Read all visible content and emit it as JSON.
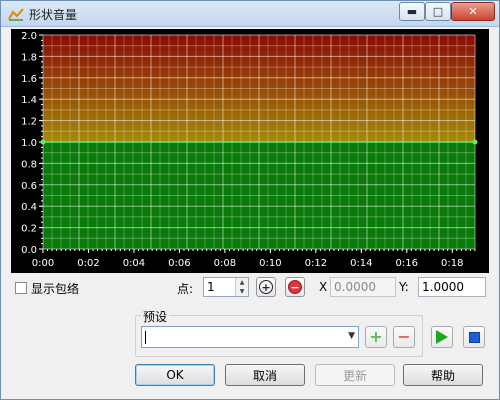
{
  "window": {
    "title": "形状音量",
    "controls": {
      "minimize": "▬",
      "maximize": "□",
      "close": "✕"
    }
  },
  "chart_data": {
    "type": "line",
    "background_gradient": [
      "#8b0b06",
      "#a38a0a",
      "#0a7a0a"
    ],
    "grid": true,
    "xlim": [
      0,
      0.19
    ],
    "ylim": [
      0,
      2.0
    ],
    "x_ticks": [
      "0:00",
      "0:02",
      "0:04",
      "0:06",
      "0:08",
      "0:10",
      "0:12",
      "0:14",
      "0:16",
      "0:18"
    ],
    "y_ticks": [
      "0.0",
      "0.2",
      "0.4",
      "0.6",
      "0.8",
      "1.0",
      "1.2",
      "1.4",
      "1.6",
      "1.8",
      "2.0"
    ],
    "series": [
      {
        "color": "#5cf06a",
        "points": [
          {
            "x": 0,
            "y": 1.0
          },
          {
            "x": 0.19,
            "y": 1.0
          }
        ]
      }
    ]
  },
  "controls": {
    "show_envelope_label": "显示包络",
    "show_envelope_checked": false,
    "point_label": "点:",
    "point_value": "1",
    "add_point_icon": "plus-circle-icon",
    "remove_point_icon": "minus-circle-icon",
    "x_label": "X",
    "x_value": "0.0000",
    "y_label": "Y:",
    "y_value": "1.0000"
  },
  "preset": {
    "group_label": "预设",
    "selected": "",
    "add_icon": "plus-icon",
    "remove_icon": "minus-icon",
    "play_icon": "play-icon",
    "stop_icon": "stop-icon"
  },
  "buttons": {
    "ok": "OK",
    "cancel": "取消",
    "update": "更新",
    "help": "帮助"
  }
}
